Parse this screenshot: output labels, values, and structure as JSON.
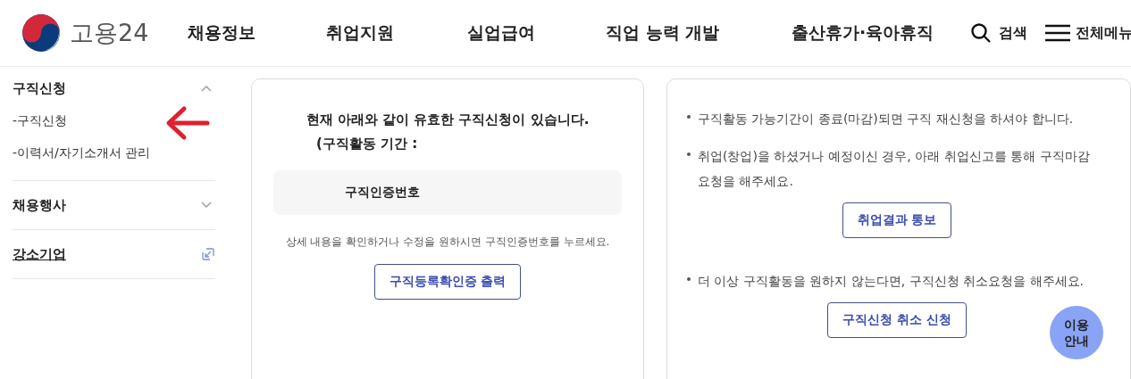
{
  "header": {
    "logo_text": "고용24",
    "nav": [
      "채용정보",
      "취업지원",
      "실업급여",
      "직업 능력 개발",
      "출산휴가·육아휴직"
    ],
    "search_label": "검색",
    "menu_label": "전체메뉴"
  },
  "sidebar": {
    "sections": [
      {
        "kind": "accordion",
        "title": "구직신청",
        "expanded": true,
        "children": [
          "-구직신청",
          "-이력서/자기소개서 관리"
        ]
      },
      {
        "kind": "accordion",
        "title": "채용행사",
        "expanded": false
      },
      {
        "kind": "link",
        "title": "강소기업"
      }
    ]
  },
  "status_card": {
    "message": "현재 아래와 같이 유효한 구직신청이 있습니다.",
    "period_label": "(구직활동 기간 :",
    "number_label": "구직인증번호",
    "hint": "상세 내용을 확인하거나 수정을 원하시면 구직인증번호를 누르세요.",
    "button": "구직등록확인증 출력"
  },
  "info_card": {
    "blocks": [
      {
        "text": "구직활동 가능기간이 종료(마감)되면 구직 재신청을 하셔야 합니다."
      },
      {
        "text": "취업(창업)을 하셨거나 예정이신 경우, 아래 취업신고를 통해 구직마감 요청을 해주세요.",
        "button": "취업결과 통보"
      },
      {
        "text": "더 이상 구직활동을 원하지 않는다면, 구직신청 취소요청을 해주세요.",
        "button": "구직신청 취소 신청"
      }
    ]
  },
  "help_button": "이용 안내"
}
